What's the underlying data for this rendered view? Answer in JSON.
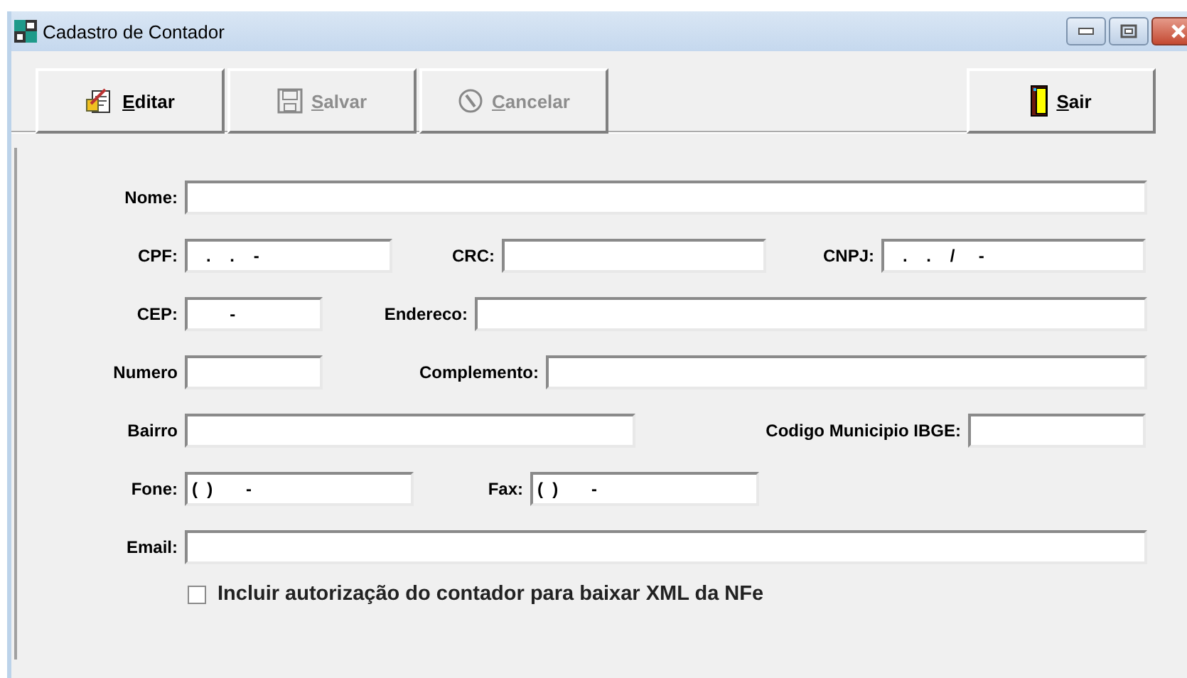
{
  "window": {
    "title": "Cadastro de Contador"
  },
  "toolbar": [
    {
      "label": "Editar",
      "kind": "edit",
      "disabled": false
    },
    {
      "label": "Salvar",
      "kind": "save",
      "disabled": true
    },
    {
      "label": "Cancelar",
      "kind": "cancel",
      "disabled": true
    },
    {
      "label": "Sair",
      "kind": "exit",
      "disabled": false
    }
  ],
  "form_rows": [
    [
      {
        "label": "Nome:"
      }
    ],
    [
      {
        "label": "CPF:",
        "value": "   .    .    -"
      },
      {
        "label": "CRC:"
      },
      {
        "label": "CNPJ:",
        "value": "   .    .    /     -"
      }
    ],
    [
      {
        "label": "CEP:",
        "value": "        -"
      },
      {
        "label": "Endereco:"
      }
    ],
    [
      {
        "label": "Numero"
      },
      {
        "label": "Complemento:"
      }
    ],
    [
      {
        "label": "Bairro"
      },
      {
        "label": "Codigo Municipio IBGE:"
      }
    ],
    [
      {
        "label": "Fone:",
        "value": "(  )       -"
      },
      {
        "label": "Fax:",
        "value": "(  )       -"
      }
    ],
    [
      {
        "label": "Email:"
      }
    ]
  ],
  "checkbox": {
    "label": "Incluir autorização do contador para baixar XML da NFe",
    "checked": false
  }
}
